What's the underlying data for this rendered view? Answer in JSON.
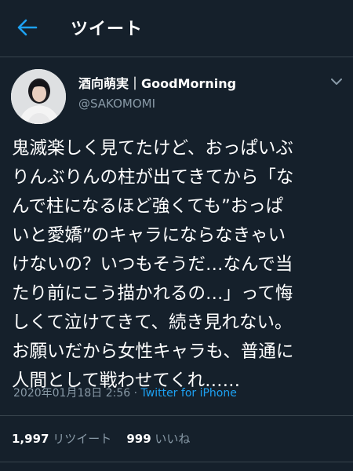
{
  "header": {
    "title": "ツイート",
    "back_icon": "back-arrow-icon"
  },
  "user": {
    "display_name": "酒向萌実｜GoodMorning",
    "handle": "@SAKOMOMI",
    "avatar_icon": "avatar-photo"
  },
  "tweet": {
    "text": "鬼滅楽しく見てたけど、おっぱいぶ\nりんぶりんの柱が出てきてから「な\nんで柱になるほど強くても”おっぱ\nいと愛嬌”のキャラにならなきゃい\nけないの？いつもそうだ…なんで当\nたり前にこう描かれるの…」って悔\nしくて泣けてきて、続き見れない。\nお願いだから女性キャラも、普通に\n人間として戦わせてくれ……",
    "timestamp": "2020年01月18日 2:56",
    "separator": " · ",
    "source": "Twitter for iPhone"
  },
  "stats": {
    "retweets_count": "1,997",
    "retweets_label": "リツイート",
    "likes_count": "999",
    "likes_label": "いいね"
  },
  "colors": {
    "background": "#15202b",
    "accent": "#1da1f2",
    "secondary_text": "#8899a6",
    "divider": "#38444d"
  }
}
